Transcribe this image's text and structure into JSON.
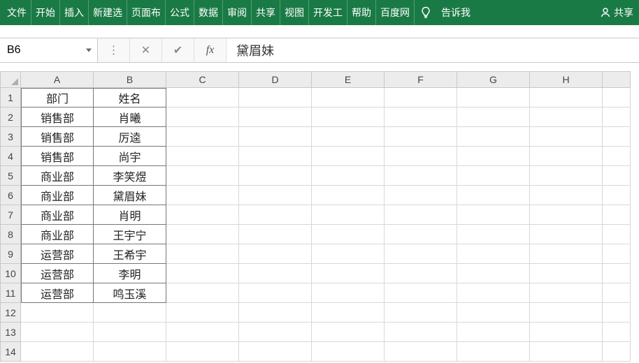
{
  "menu": {
    "items": [
      "文件",
      "开始",
      "插入",
      "新建选",
      "页面布",
      "公式",
      "数据",
      "审阅",
      "共享",
      "视图",
      "开发工",
      "帮助",
      "百度网"
    ],
    "tell_me": "告诉我",
    "share": "共享"
  },
  "formula_bar": {
    "name_box": "B6",
    "value": "黛眉妹",
    "fx_label": "fx"
  },
  "columns": [
    "A",
    "B",
    "C",
    "D",
    "E",
    "F",
    "G",
    "H",
    ""
  ],
  "row_count": 14,
  "table": {
    "header": [
      "部门",
      "姓名"
    ],
    "rows": [
      [
        "销售部",
        "肖曦"
      ],
      [
        "销售部",
        "厉逵"
      ],
      [
        "销售部",
        "尚宇"
      ],
      [
        "商业部",
        "李笑煜"
      ],
      [
        "商业部",
        "黛眉妹"
      ],
      [
        "商业部",
        "肖明"
      ],
      [
        "商业部",
        "王宇宁"
      ],
      [
        "运营部",
        "王希宇"
      ],
      [
        "运营部",
        "李明"
      ],
      [
        "运营部",
        "鸣玉溪"
      ]
    ]
  }
}
